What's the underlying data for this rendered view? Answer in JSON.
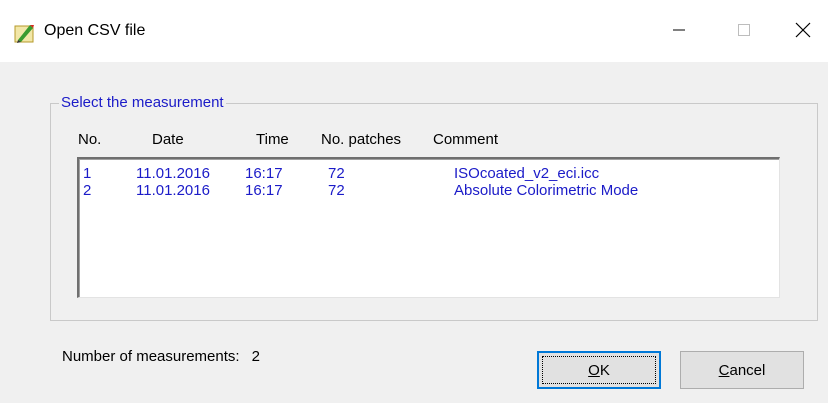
{
  "window": {
    "title": "Open CSV file",
    "icon": "csv-pencil-icon"
  },
  "titlebar_buttons": {
    "minimize": "minimize-icon",
    "maximize": "maximize-icon",
    "close": "close-icon"
  },
  "group": {
    "label": "Select the measurement",
    "columns": {
      "no": "No.",
      "date": "Date",
      "time": "Time",
      "patches": "No. patches",
      "comment": "Comment"
    },
    "rows": [
      {
        "no": "1",
        "date": "11.01.2016",
        "time": "16:17",
        "patches": "72",
        "comment": "ISOcoated_v2_eci.icc"
      },
      {
        "no": "2",
        "date": "11.01.2016",
        "time": "16:17",
        "patches": "72",
        "comment": "Absolute Colorimetric Mode"
      }
    ]
  },
  "footer": {
    "count_label": "Number of measurements:",
    "count_value": "2"
  },
  "buttons": {
    "ok_first": "O",
    "ok_rest": "K",
    "cancel_first": "C",
    "cancel_rest": "ancel"
  },
  "colors": {
    "accent_text": "#1b1bc8",
    "focus_border": "#0078d7",
    "dialog_bg": "#f0f0f0"
  }
}
